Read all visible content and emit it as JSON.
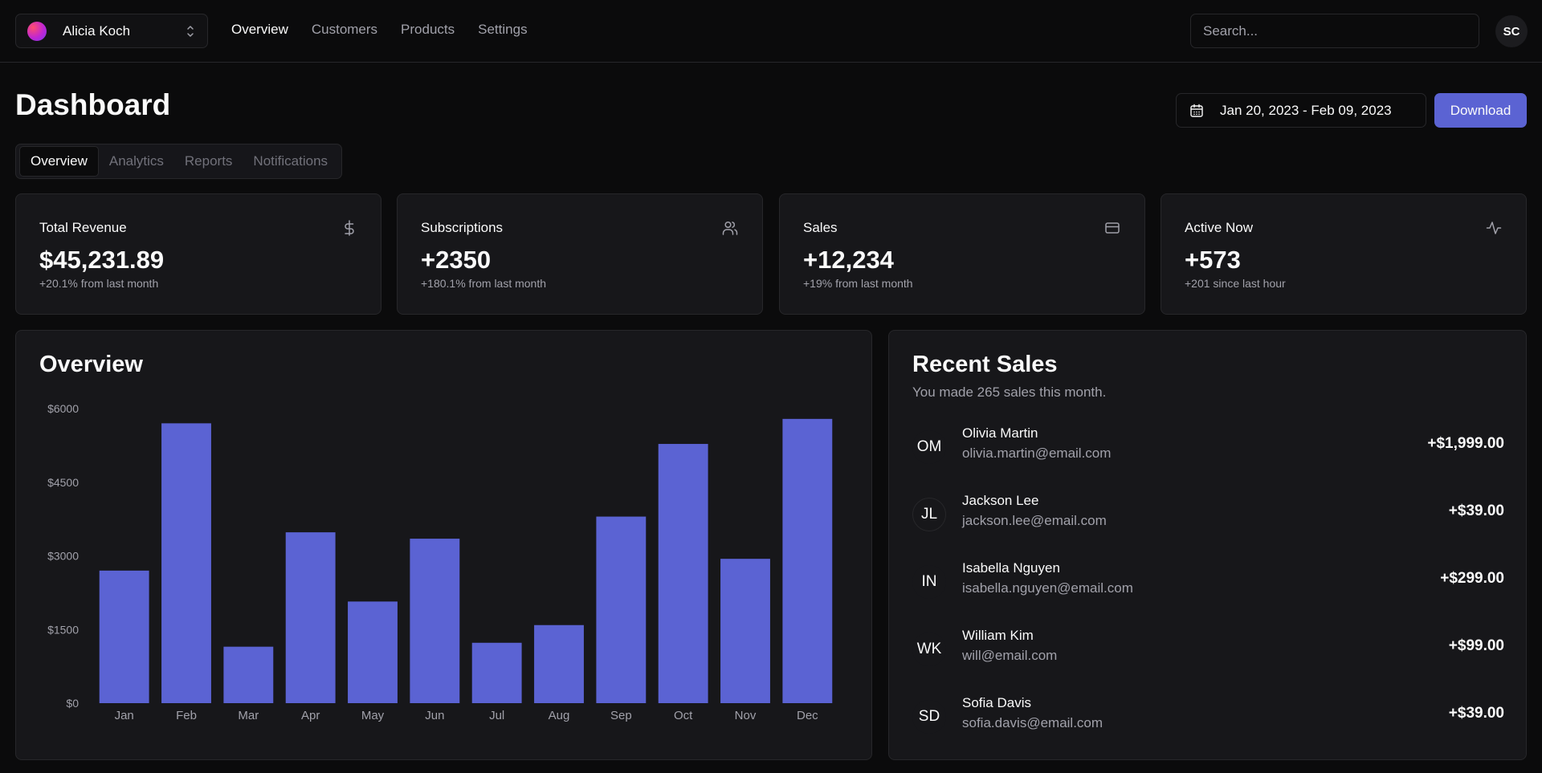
{
  "topbar": {
    "team_name": "Alicia Koch",
    "nav": [
      {
        "label": "Overview",
        "active": true
      },
      {
        "label": "Customers",
        "active": false
      },
      {
        "label": "Products",
        "active": false
      },
      {
        "label": "Settings",
        "active": false
      }
    ],
    "search_placeholder": "Search...",
    "user_initials": "SC"
  },
  "header": {
    "title": "Dashboard",
    "date_range": "Jan 20, 2023 - Feb 09, 2023",
    "download_label": "Download"
  },
  "tabs": [
    {
      "label": "Overview",
      "active": true
    },
    {
      "label": "Analytics",
      "active": false
    },
    {
      "label": "Reports",
      "active": false
    },
    {
      "label": "Notifications",
      "active": false
    }
  ],
  "stats": [
    {
      "title": "Total Revenue",
      "value": "$45,231.89",
      "sub": "+20.1% from last month",
      "icon": "dollar-icon"
    },
    {
      "title": "Subscriptions",
      "value": "+2350",
      "sub": "+180.1% from last month",
      "icon": "users-icon"
    },
    {
      "title": "Sales",
      "value": "+12,234",
      "sub": "+19% from last month",
      "icon": "credit-card-icon"
    },
    {
      "title": "Active Now",
      "value": "+573",
      "sub": "+201 since last hour",
      "icon": "activity-icon"
    }
  ],
  "overview": {
    "title": "Overview"
  },
  "chart_data": {
    "type": "bar",
    "categories": [
      "Jan",
      "Feb",
      "Mar",
      "Apr",
      "May",
      "Jun",
      "Jul",
      "Aug",
      "Sep",
      "Oct",
      "Nov",
      "Dec"
    ],
    "values": [
      2700,
      5700,
      1150,
      3480,
      2070,
      3350,
      1230,
      1590,
      3800,
      5280,
      2940,
      5790
    ],
    "ylim": [
      0,
      6000
    ],
    "yticks": [
      0,
      1500,
      3000,
      4500,
      6000
    ],
    "ytick_labels": [
      "$0",
      "$1500",
      "$3000",
      "$4500",
      "$6000"
    ],
    "bar_color": "#5b63d3",
    "grid": false
  },
  "recent_sales": {
    "title": "Recent Sales",
    "subtitle": "You made 265 sales this month.",
    "items": [
      {
        "initials": "OM",
        "name": "Olivia Martin",
        "email": "olivia.martin@email.com",
        "amount": "+$1,999.00"
      },
      {
        "initials": "JL",
        "name": "Jackson Lee",
        "email": "jackson.lee@email.com",
        "amount": "+$39.00"
      },
      {
        "initials": "IN",
        "name": "Isabella Nguyen",
        "email": "isabella.nguyen@email.com",
        "amount": "+$299.00"
      },
      {
        "initials": "WK",
        "name": "William Kim",
        "email": "will@email.com",
        "amount": "+$99.00"
      },
      {
        "initials": "SD",
        "name": "Sofia Davis",
        "email": "sofia.davis@email.com",
        "amount": "+$39.00"
      }
    ]
  },
  "colors": {
    "accent": "#5b63d3",
    "background": "#0b0b0c",
    "card": "#17171a",
    "border": "#27272a",
    "muted_text": "#a1a1aa"
  }
}
